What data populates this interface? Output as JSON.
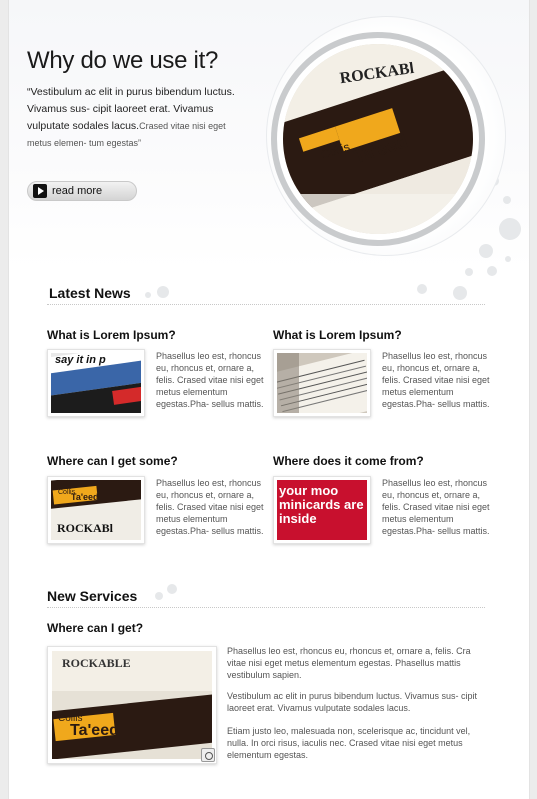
{
  "hero": {
    "title": "Why do we use it?",
    "text_main": "“Vestibulum ac elit in purus bibendum luctus. Vivamus sus- cipit laoreet erat. Vivamus vulputate sodales lacus.",
    "text_faded": "Crased vitae nisi eget metus elemen- tum egestas”",
    "read_more": "read more"
  },
  "latest_news": {
    "heading": "Latest News",
    "items": [
      {
        "title": "What is Lorem Ipsum?",
        "text": "Phasellus leo est, rhoncus eu, rhoncus et, ornare a, felis. Crased vitae nisi eget metus elementum egestas.Pha- sellus mattis."
      },
      {
        "title": "What is Lorem Ipsum?",
        "text": "Phasellus leo est, rhoncus eu, rhoncus et, ornare a, felis. Crased vitae nisi eget metus elementum egestas.Pha- sellus mattis."
      },
      {
        "title": "Where can I get some?",
        "text": "Phasellus leo est, rhoncus eu, rhoncus et, ornare a, felis. Crased vitae nisi eget metus elementum egestas.Pha- sellus mattis."
      },
      {
        "title": "Where does it come from?",
        "text": "Phasellus leo est, rhoncus eu, rhoncus et, ornare a, felis. Crased vitae nisi eget metus elementum egestas.Pha- sellus mattis."
      }
    ]
  },
  "thumb_texts": {
    "say_it": "say it in p",
    "rockab": "ROCKABl",
    "collis": "Collis",
    "taeed": "Ta'eed",
    "moo": "your moo minicards are inside"
  },
  "new_services": {
    "heading": "New Services",
    "title": "Where can I get?",
    "paragraphs": [
      "Phasellus leo est, rhoncus eu, rhoncus et, ornare a, felis. Cra vitae nisi eget metus elementum egestas. Phasellus mattis vestibulum sapien.",
      "Vestibulum ac elit in purus bibendum luctus. Vivamus sus- cipit laoreet erat. Vivamus vulputate sodales lacus.",
      "Etiam justo leo, malesuada non, scelerisque ac, tincidunt vel, nulla. In orci risus, iaculis nec. Crased vitae nisi eget metus elementum egestas."
    ],
    "image_text": {
      "rockable": "ROCKABLE",
      "collis": "Collis",
      "taeed": "Ta'eed"
    }
  },
  "colors": {
    "accent_orange": "#f0a81c",
    "card_dark": "#2b1a12",
    "moo_red": "#c8102e"
  }
}
